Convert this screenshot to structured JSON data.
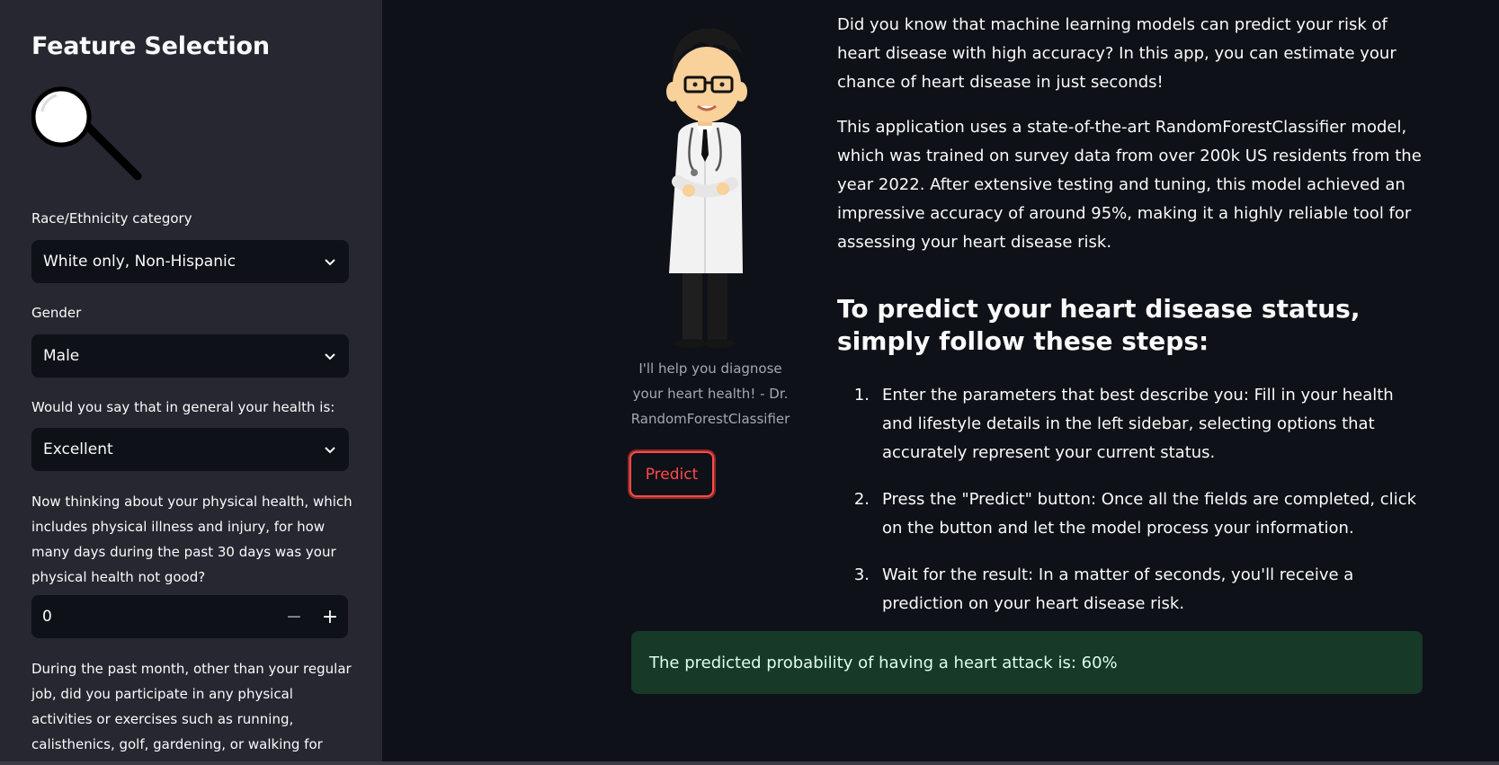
{
  "sidebar": {
    "title": "Feature Selection",
    "race_label": "Race/Ethnicity category",
    "race_value": "White only, Non-Hispanic",
    "gender_label": "Gender",
    "gender_value": "Male",
    "health_label": "Would you say that in general your health is:",
    "health_value": "Excellent",
    "physical_label": "Now thinking about your physical health, which includes physical illness and injury, for how many days during the past 30 days was your physical health not good?",
    "physical_value": "0",
    "minus": "−",
    "plus": "+",
    "activity_label": "During the past month, other than your regular job, did you participate in any physical activities or exercises such as running, calisthenics, golf, gardening, or walking for exercise?"
  },
  "main": {
    "caption": "I'll help you diagnose your heart health! - Dr. RandomForestClassifier",
    "predict_label": "Predict",
    "intro": "Did you know that machine learning models can predict your risk of heart disease with high accuracy? In this app, you can estimate your chance of heart disease in just seconds!",
    "description": "This application uses a state-of-the-art RandomForestClassifier model, which was trained on survey data from over 200k US residents from the year 2022. After extensive testing and tuning, this model achieved an impressive accuracy of around 95%, making it a highly reliable tool for assessing your heart disease risk.",
    "steps_title": "To predict your heart disease status, simply follow these steps:",
    "steps": [
      {
        "num": "1.",
        "text": "Enter the parameters that best describe you: Fill in your health and lifestyle details in the left sidebar, selecting options that accurately represent your current status."
      },
      {
        "num": "2.",
        "text": "Press the \"Predict\" button: Once all the fields are completed, click on the button and let the model process your information."
      },
      {
        "num": "3.",
        "text": "Wait for the result: In a matter of seconds, you'll receive a prediction on your heart disease risk."
      }
    ],
    "result": "The predicted probability of having a heart attack is: 60%"
  },
  "colors": {
    "sidebar_bg": "#262730",
    "app_bg": "#0e1117",
    "accent": "#ff4b4b",
    "success_bg": "#173928"
  }
}
